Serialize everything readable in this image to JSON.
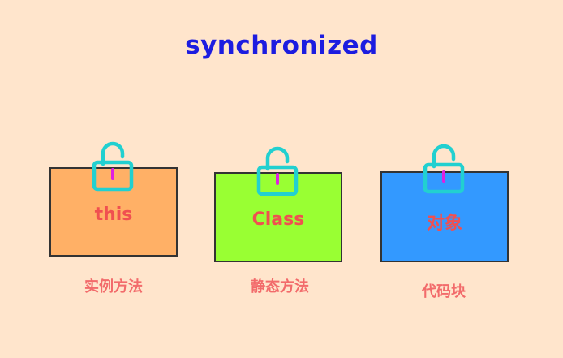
{
  "title": "synchronized",
  "colors": {
    "background": "#ffe5cc",
    "title": "#1c1ce0",
    "box_border": "#333333",
    "box_text": "#f05050",
    "caption": "#f26b6b",
    "lock_stroke": "#22d0d0",
    "keyhole": "#e020e0"
  },
  "boxes": [
    {
      "label": "this",
      "caption": "实例方法",
      "color": "#ffb066",
      "icon": "unlocked-padlock-icon"
    },
    {
      "label": "Class",
      "caption": "静态方法",
      "color": "#99ff33",
      "icon": "unlocked-padlock-icon"
    },
    {
      "label": "对象",
      "caption": "代码块",
      "color": "#3399ff",
      "icon": "unlocked-padlock-icon"
    }
  ]
}
